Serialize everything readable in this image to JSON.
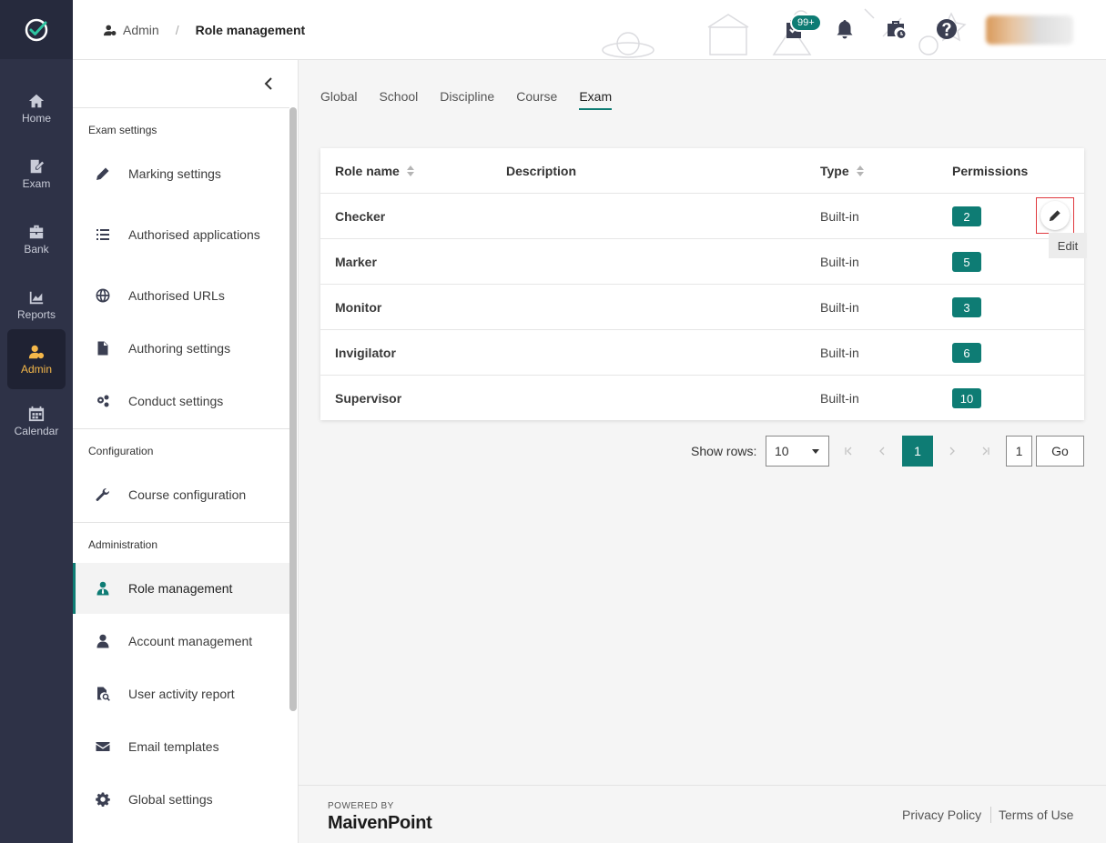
{
  "rail": {
    "items": [
      {
        "label": "Home",
        "icon": "home-icon"
      },
      {
        "label": "Exam",
        "icon": "exam-icon"
      },
      {
        "label": "Bank",
        "icon": "bank-icon"
      },
      {
        "label": "Reports",
        "icon": "reports-icon"
      },
      {
        "label": "Admin",
        "icon": "admin-icon",
        "active": true
      },
      {
        "label": "Calendar",
        "icon": "calendar-icon"
      }
    ]
  },
  "header": {
    "breadcrumb_root": "Admin",
    "breadcrumb_sep": "/",
    "breadcrumb_current": "Role management",
    "tasks_badge": "99+"
  },
  "sidebar": {
    "sections": [
      {
        "title": "Exam settings",
        "items": [
          {
            "label": "Marking settings",
            "icon": "pencil-icon"
          },
          {
            "label": "Authorised applications",
            "icon": "list-icon"
          },
          {
            "label": "Authorised URLs",
            "icon": "globe-icon"
          },
          {
            "label": "Authoring settings",
            "icon": "document-icon"
          },
          {
            "label": "Conduct settings",
            "icon": "cogs-icon"
          }
        ]
      },
      {
        "title": "Configuration",
        "items": [
          {
            "label": "Course configuration",
            "icon": "wrench-icon"
          }
        ]
      },
      {
        "title": "Administration",
        "items": [
          {
            "label": "Role management",
            "icon": "role-icon",
            "active": true
          },
          {
            "label": "Account management",
            "icon": "user-icon"
          },
          {
            "label": "User activity report",
            "icon": "activity-report-icon"
          },
          {
            "label": "Email templates",
            "icon": "envelope-icon"
          },
          {
            "label": "Global settings",
            "icon": "gear-icon"
          }
        ]
      }
    ]
  },
  "tabs": [
    "Global",
    "School",
    "Discipline",
    "Course",
    "Exam"
  ],
  "active_tab": "Exam",
  "table": {
    "headers": {
      "role_name": "Role name",
      "description": "Description",
      "type": "Type",
      "permissions": "Permissions"
    },
    "rows": [
      {
        "role_name": "Checker",
        "description": "",
        "type": "Built-in",
        "permissions": "2"
      },
      {
        "role_name": "Marker",
        "description": "",
        "type": "Built-in",
        "permissions": "5"
      },
      {
        "role_name": "Monitor",
        "description": "",
        "type": "Built-in",
        "permissions": "3"
      },
      {
        "role_name": "Invigilator",
        "description": "",
        "type": "Built-in",
        "permissions": "6"
      },
      {
        "role_name": "Supervisor",
        "description": "",
        "type": "Built-in",
        "permissions": "10"
      }
    ],
    "edit_tooltip": "Edit"
  },
  "pagination": {
    "show_rows_label": "Show rows:",
    "rows_value": "10",
    "current_page": "1",
    "page_input": "1",
    "go_label": "Go"
  },
  "footer": {
    "powered_by": "POWERED BY",
    "brand": "MaivenPoint",
    "privacy": "Privacy Policy",
    "terms": "Terms of Use"
  },
  "colors": {
    "accent": "#0e7c74",
    "rail_bg": "#2e3247",
    "rail_active": "#f5b84a"
  }
}
